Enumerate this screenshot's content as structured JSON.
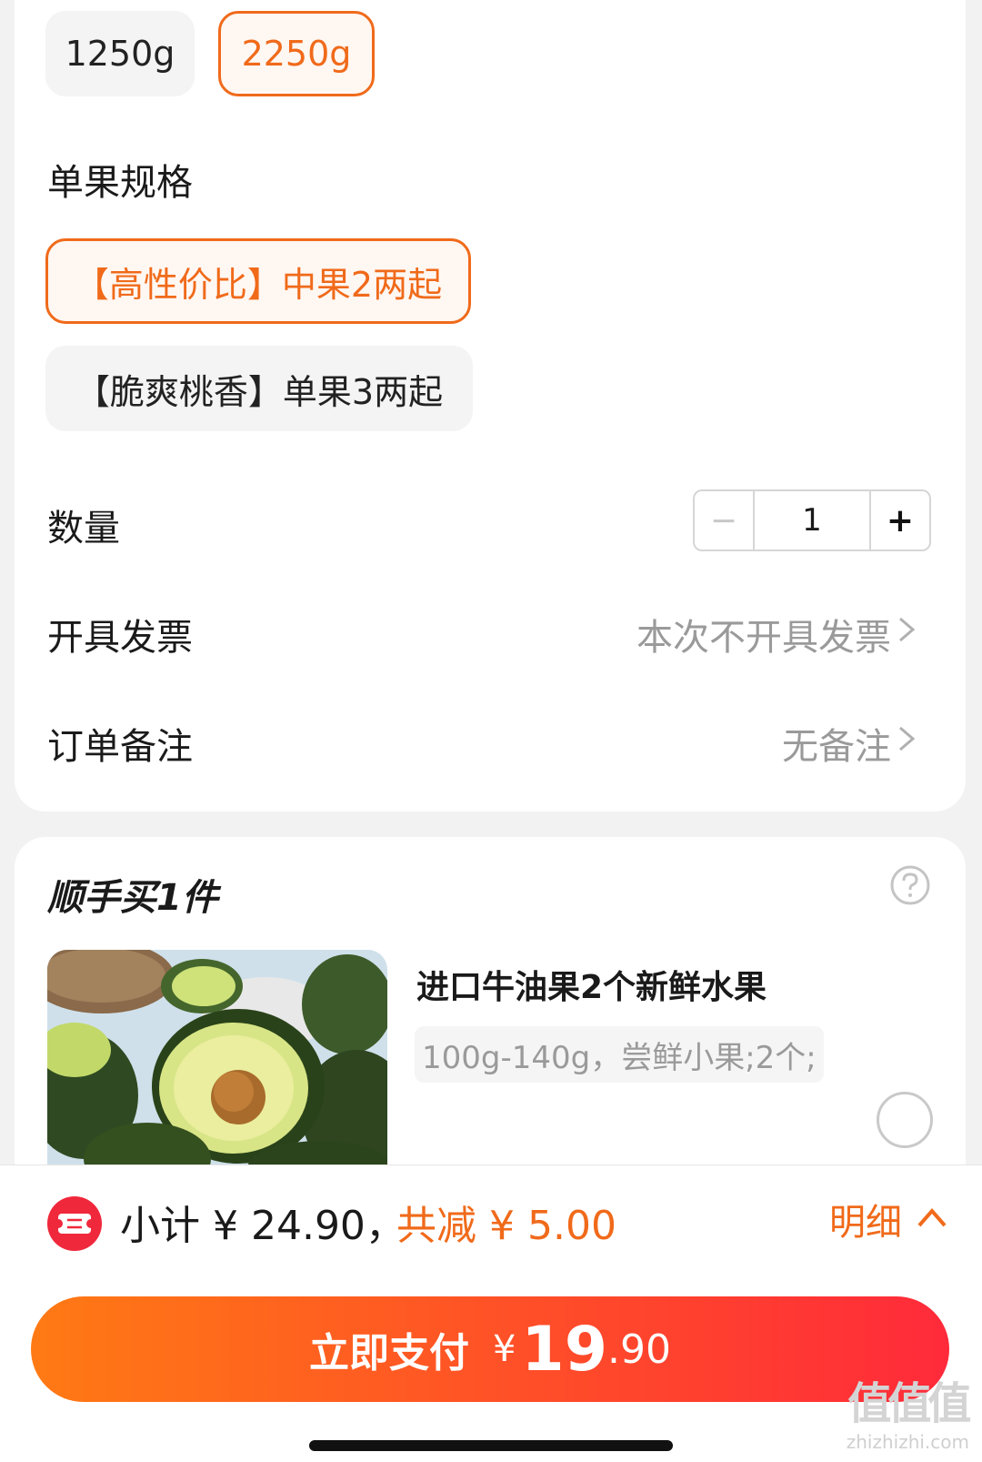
{
  "weight_options": [
    {
      "label": "1250g",
      "selected": false
    },
    {
      "label": "2250g",
      "selected": true
    }
  ],
  "fruit_spec": {
    "title": "单果规格",
    "options": [
      {
        "label": "【高性价比】中果2两起",
        "selected": true
      },
      {
        "label": "【脆爽桃香】单果3两起",
        "selected": false
      }
    ]
  },
  "quantity": {
    "label": "数量",
    "minus": "−",
    "value": "1",
    "plus": "+"
  },
  "invoice": {
    "label": "开具发票",
    "value": "本次不开具发票"
  },
  "order_note": {
    "label": "订单备注",
    "value": "无备注"
  },
  "addon": {
    "title": "顺手买1件",
    "product_name": "进口牛油果2个新鲜水果",
    "product_spec": "100g-140g，尝鲜小果;2个;"
  },
  "summary": {
    "subtotal": "小计 ¥ 24.90，",
    "discount": "共减 ¥ 5.00",
    "detail": "明细"
  },
  "pay_button": {
    "label": "立即支付",
    "currency": "¥",
    "amount_int": "19",
    "amount_dec": ".90"
  },
  "watermark": {
    "logo": "值值值",
    "url": "zhizhizhi.com"
  },
  "colors": {
    "accent": "#f06a1a",
    "pay_gradient_start": "#ff7a14",
    "pay_gradient_end": "#ff2a3a"
  }
}
